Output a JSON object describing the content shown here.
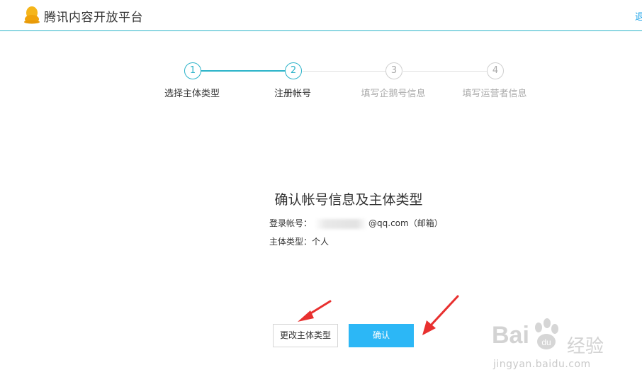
{
  "header": {
    "brand": "腾讯内容开放平台",
    "logout": "退出"
  },
  "steps": [
    {
      "number": "1",
      "label": "选择主体类型",
      "state": "active"
    },
    {
      "number": "2",
      "label": "注册帐号",
      "state": "active"
    },
    {
      "number": "3",
      "label": "填写企鹅号信息",
      "state": "inactive"
    },
    {
      "number": "4",
      "label": "填写运营者信息",
      "state": "inactive"
    }
  ],
  "confirm": {
    "title": "确认帐号信息及主体类型",
    "account_label": "登录帐号：",
    "account_suffix": "@qq.com（邮箱）",
    "type_label": "主体类型：",
    "type_value": "个人"
  },
  "buttons": {
    "change_type": "更改主体类型",
    "confirm": "确认"
  },
  "watermark": {
    "logo": "Bai",
    "logo_tail": "经验",
    "url": "jingyan.baidu.com"
  },
  "colors": {
    "accent": "#2bb3c9",
    "primary_button": "#2cb7f6",
    "annotation_arrow": "#e8302f"
  }
}
